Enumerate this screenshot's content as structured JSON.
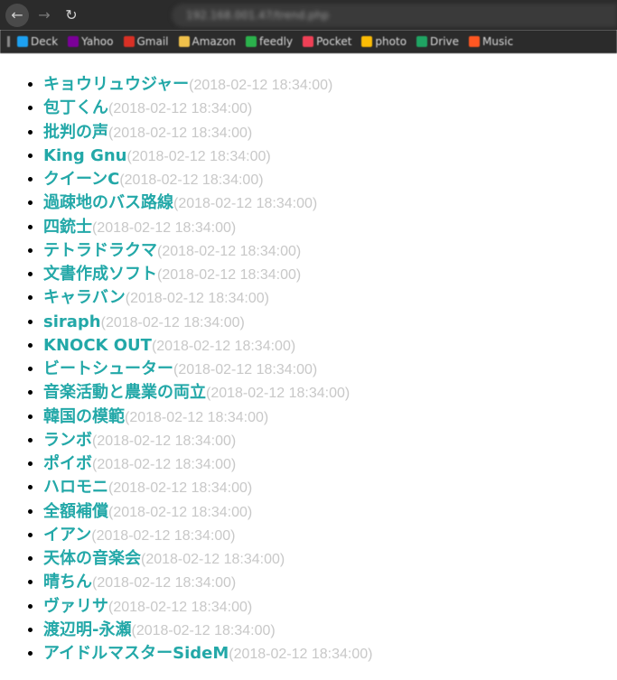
{
  "browser": {
    "back_glyph": "←",
    "forward_glyph": "→",
    "reload_glyph": "↻",
    "url": "192.168.001.47/trend.php"
  },
  "bookmarks": [
    {
      "label": "Deck",
      "icon": "deck-icon",
      "color": "#1da1f2"
    },
    {
      "label": "Yahoo",
      "icon": "yahoo-icon",
      "color": "#7b0099"
    },
    {
      "label": "Gmail",
      "icon": "gmail-icon",
      "color": "#d93025"
    },
    {
      "label": "Amazon",
      "icon": "amazon-icon",
      "color": "#f0c14b"
    },
    {
      "label": "feedly",
      "icon": "feedly-icon",
      "color": "#2bb24c"
    },
    {
      "label": "Pocket",
      "icon": "pocket-icon",
      "color": "#ef4056"
    },
    {
      "label": "photo",
      "icon": "photos-icon",
      "color": "#fbbc05"
    },
    {
      "label": "Drive",
      "icon": "drive-icon",
      "color": "#1fa463"
    },
    {
      "label": "Music",
      "icon": "music-icon",
      "color": "#ff5722"
    }
  ],
  "accent_color": "#23a8a8",
  "date_color": "#c8c8c8",
  "trends": [
    {
      "name": "キョウリュウジャー",
      "date": "(2018-02-12 18:34:00)"
    },
    {
      "name": "包丁くん",
      "date": "(2018-02-12 18:34:00)"
    },
    {
      "name": "批判の声",
      "date": "(2018-02-12 18:34:00)"
    },
    {
      "name": "King Gnu",
      "date": "(2018-02-12 18:34:00)"
    },
    {
      "name": "クイーンC",
      "date": "(2018-02-12 18:34:00)"
    },
    {
      "name": "過疎地のバス路線",
      "date": "(2018-02-12 18:34:00)"
    },
    {
      "name": "四銃士",
      "date": "(2018-02-12 18:34:00)"
    },
    {
      "name": "テトラドラクマ",
      "date": "(2018-02-12 18:34:00)"
    },
    {
      "name": "文書作成ソフト",
      "date": "(2018-02-12 18:34:00)"
    },
    {
      "name": "キャラバン",
      "date": "(2018-02-12 18:34:00)"
    },
    {
      "name": "siraph",
      "date": "(2018-02-12 18:34:00)"
    },
    {
      "name": "KNOCK OUT",
      "date": "(2018-02-12 18:34:00)"
    },
    {
      "name": "ビートシューター",
      "date": "(2018-02-12 18:34:00)"
    },
    {
      "name": "音楽活動と農業の両立",
      "date": "(2018-02-12 18:34:00)"
    },
    {
      "name": "韓国の模範",
      "date": "(2018-02-12 18:34:00)"
    },
    {
      "name": "ランボ",
      "date": "(2018-02-12 18:34:00)"
    },
    {
      "name": "ポイボ",
      "date": "(2018-02-12 18:34:00)"
    },
    {
      "name": "ハロモニ",
      "date": "(2018-02-12 18:34:00)"
    },
    {
      "name": "全額補償",
      "date": "(2018-02-12 18:34:00)"
    },
    {
      "name": "イアン",
      "date": "(2018-02-12 18:34:00)"
    },
    {
      "name": "天体の音楽会",
      "date": "(2018-02-12 18:34:00)"
    },
    {
      "name": "晴ちん",
      "date": "(2018-02-12 18:34:00)"
    },
    {
      "name": "ヴァリサ",
      "date": "(2018-02-12 18:34:00)"
    },
    {
      "name": "渡辺明-永瀬",
      "date": "(2018-02-12 18:34:00)"
    },
    {
      "name": "アイドルマスターSideM",
      "date": "(2018-02-12 18:34:00)"
    }
  ]
}
